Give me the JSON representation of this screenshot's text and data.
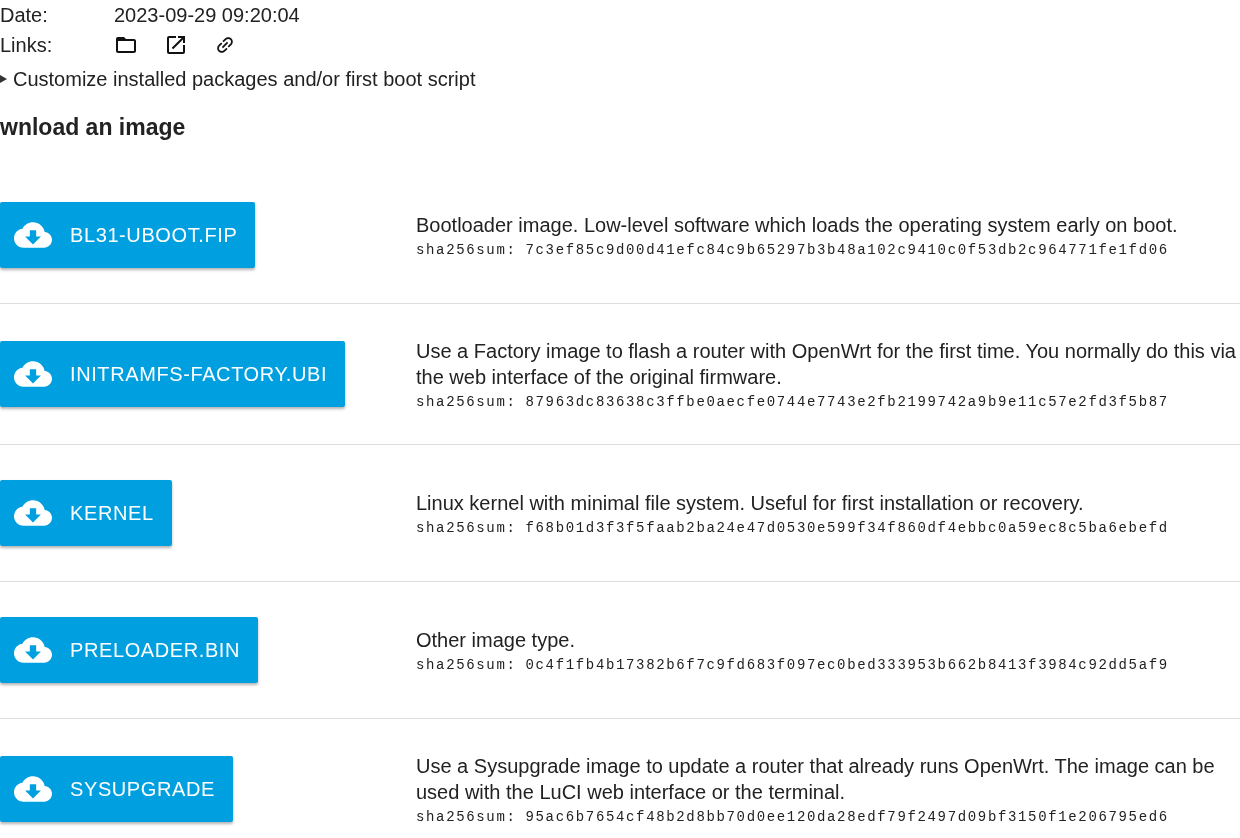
{
  "info": [
    {
      "label": "Date:",
      "value": "2023-09-29 09:20:04"
    }
  ],
  "links": {
    "label": "Links:",
    "items": [
      {
        "kind": "folder"
      },
      {
        "kind": "external"
      },
      {
        "kind": "link"
      }
    ]
  },
  "customize": {
    "text": "Customize installed packages and/or first boot script",
    "expanded": false
  },
  "heading": "wnload an image",
  "images": [
    {
      "button": "BL31-UBOOT.FIP",
      "description": "Bootloader image. Low-level software which loads the operating system early on boot.",
      "sha_label": "sha256sum:",
      "sha": "7c3ef85c9d00d41efc84c9b65297b3b48a102c9410c0f53db2c964771fe1fd06"
    },
    {
      "button": "INITRAMFS-FACTORY.UBI",
      "description": "Use a Factory image to flash a router with OpenWrt for the first time. You normally do this via the web interface of the original firmware.",
      "sha_label": "sha256sum:",
      "sha": "87963dc83638c3ffbe0aecfe0744e7743e2fb2199742a9b9e11c57e2fd3f5b87"
    },
    {
      "button": "KERNEL",
      "description": "Linux kernel with minimal file system. Useful for first installation or recovery.",
      "sha_label": "sha256sum:",
      "sha": "f68b01d3f3f5faab2ba24e47d0530e599f34f860df4ebbc0a59ec8c5ba6ebefd"
    },
    {
      "button": "PRELOADER.BIN",
      "description": "Other image type.",
      "sha_label": "sha256sum:",
      "sha": "0c4f1fb4b17382b6f7c9fd683f097ec0bed333953b662b8413f3984c92dd5af9"
    },
    {
      "button": "SYSUPGRADE",
      "description": "Use a Sysupgrade image to update a router that already runs OpenWrt. The image can be used with the LuCI web interface or the terminal.",
      "sha_label": "sha256sum:",
      "sha": "95ac6b7654cf48b2d8bb70d0ee120da28edf79f2497d09bf3150f1e206795ed6"
    }
  ]
}
